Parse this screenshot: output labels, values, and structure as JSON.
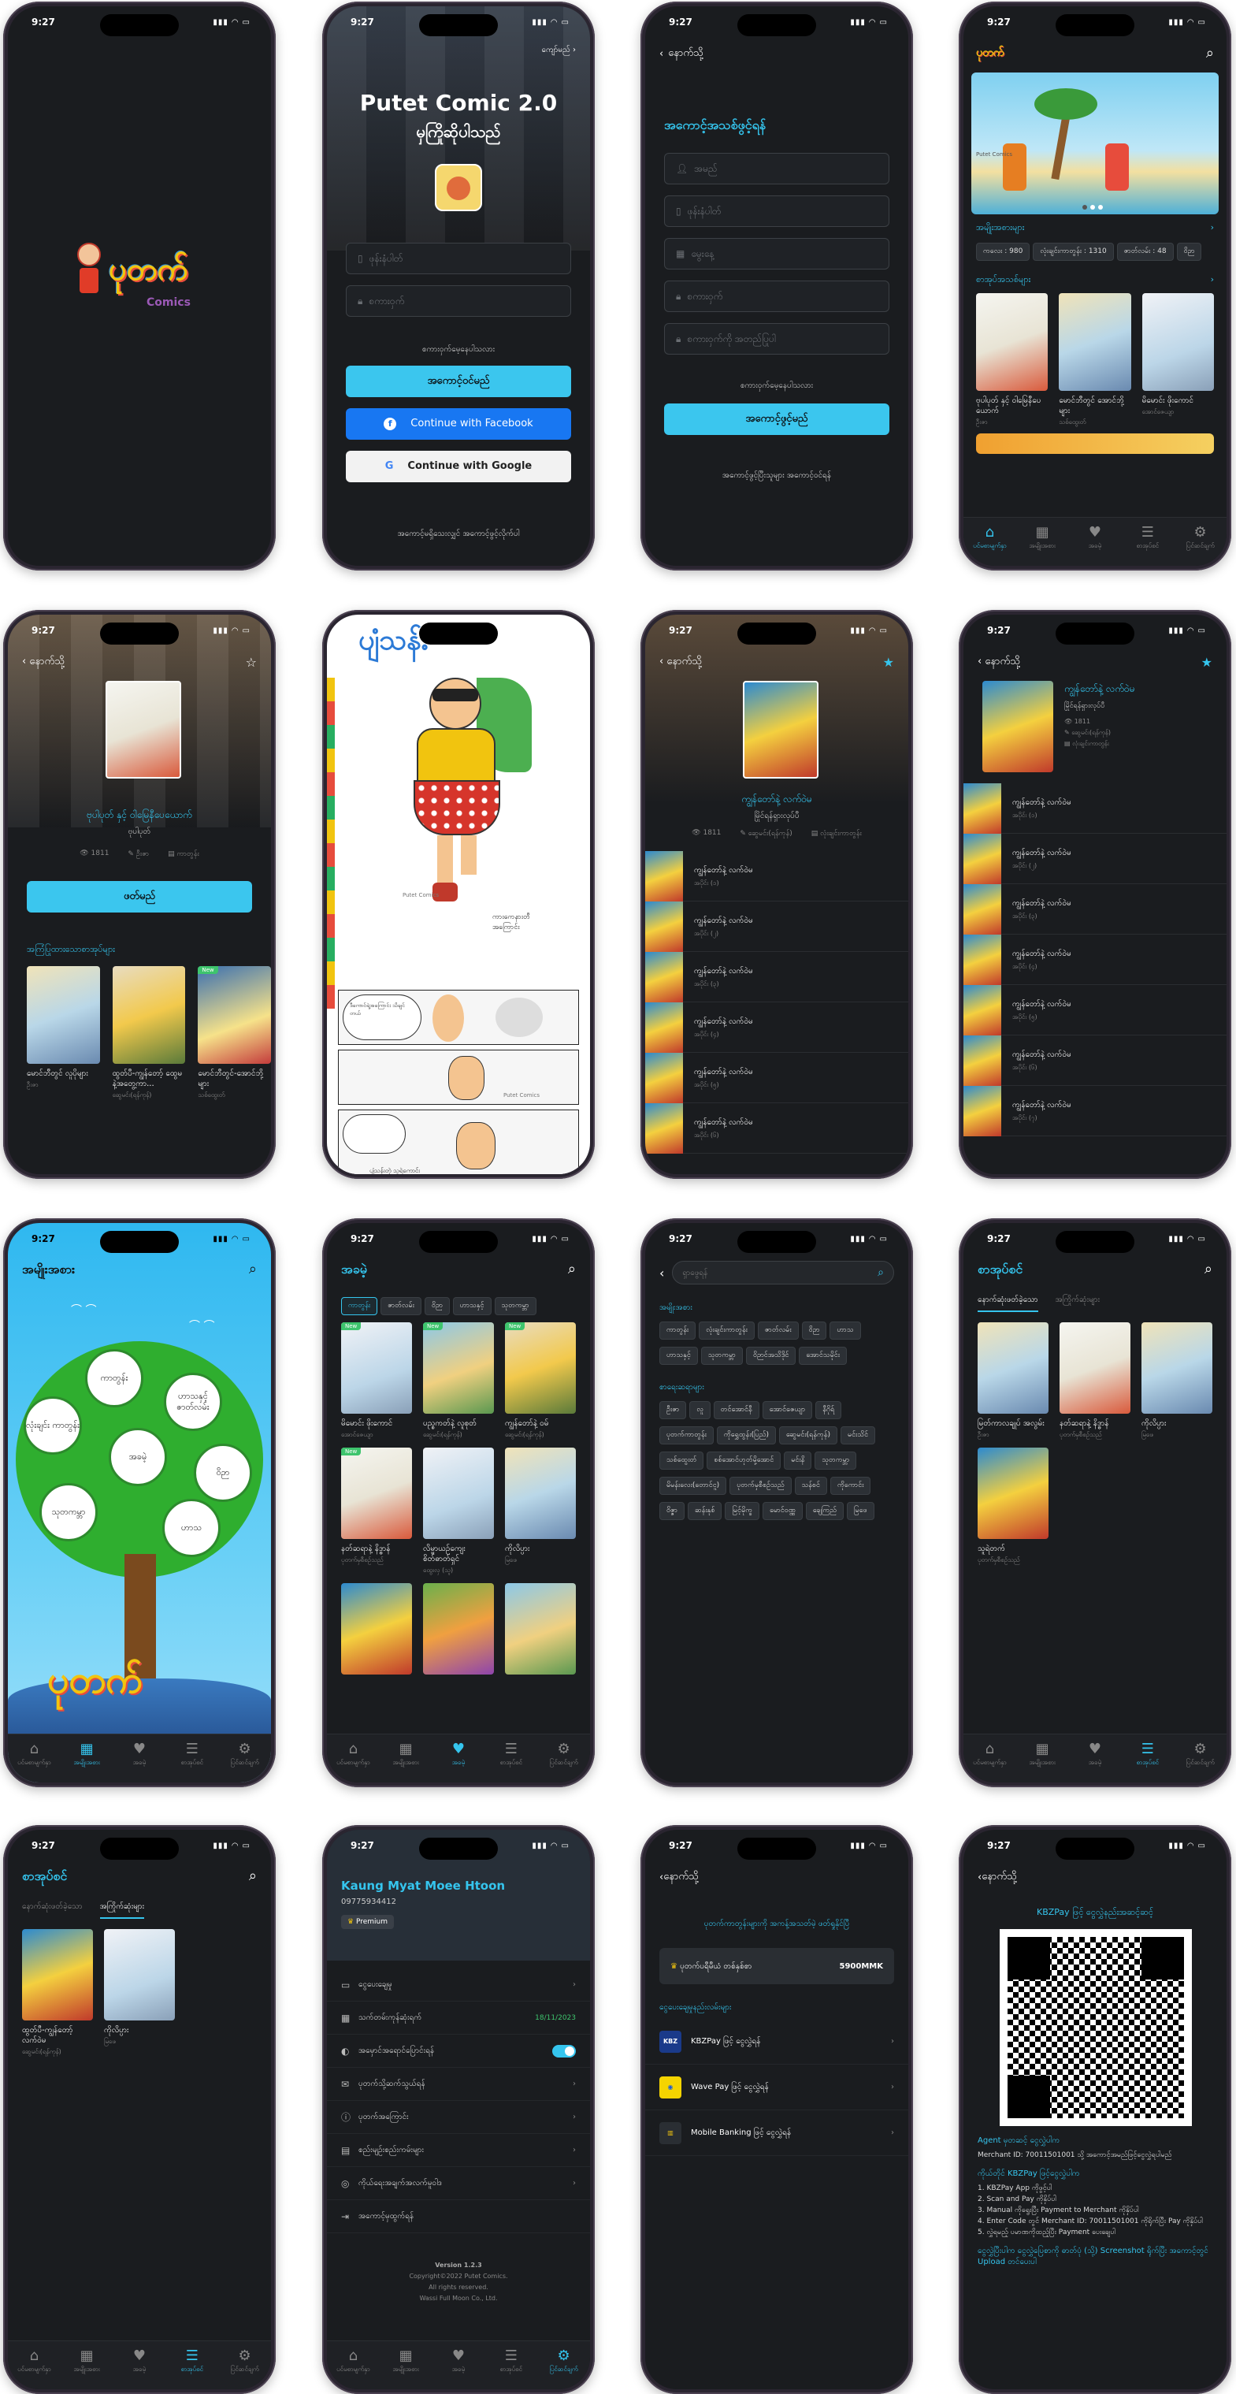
{
  "status_time": "9:27",
  "login": {
    "skip": "ကျော်မည်",
    "title": "Putet Comic 2.0",
    "welcome": "မှကြိုဆိုပါသည်",
    "phone_placeholder": "ဖုန်းနံပါတ်",
    "password_placeholder": "စကားဝှက်",
    "forgot": "စကားဝှက်မေ့နေပါသလား",
    "login_btn": "အကောင့်ဝင်မည်",
    "facebook_btn": "Continue with Facebook",
    "google_btn": "Continue with Google",
    "register_link": "အကောင့်မရှိသေးလျှင် အကောင့်ဖွင့်လိုက်ပါ"
  },
  "logo": {
    "brand": "ပုတက်",
    "sub": "Comics"
  },
  "register": {
    "back": "နောက်သို့",
    "title": "အကောင့်အသစ်ဖွင့်ရန်",
    "fields": [
      "အမည်",
      "ဖုန်းနံပါတ်",
      "မွေးနေ့",
      "စကားဝှက်",
      "စကားဝှက်ကို အတည်ပြုပါ"
    ],
    "forgot": "စကားဝှက်မေ့နေပါသလား",
    "submit": "အကောင့်ဖွင့်မည်",
    "login_link": "အကောင့်ဖွင့်ပြီးသူများ အကောင့်ဝင်ရန်"
  },
  "home": {
    "banner_text": "Putet Comics",
    "genres_title": "အမျိုးအစားများ",
    "genre_chips": [
      "ကလေး : 980",
      "လုံးချင်းကာတွန်း : 1310",
      "ဇာတ်လမ်း : 48",
      "ဝိဉာ"
    ],
    "books_title": "စာအုပ်အသစ်များ",
    "books": [
      {
        "title": "ဗုပါပုတ် နှင့် ဝါမြေနီပေယောက်",
        "author": "ဦးဇာ"
      },
      {
        "title": "မောင်ဘီတွင် အောင်ဘို့များ",
        "author": "သစ်ထွေးတ်"
      },
      {
        "title": "မိမောင်း ဖိုးကောင်",
        "author": "အောင်ဇေယျာ"
      }
    ]
  },
  "tabs": [
    "ပင်မစာမျက်နှာ",
    "အမျိုးအစား",
    "အခမဲ့",
    "စာအုပ်စင်",
    "ပြင်ဆင်ချက်"
  ],
  "detail1": {
    "back": "နောက်သို့",
    "title": "ဗုပါပုတ် နှင့် ဝါမြေနီပေယောက်",
    "author": "ဗုပါပုတ်",
    "views": "1811",
    "writer": "ဦးဇာ",
    "genre": "ကာတွန်း",
    "read_btn": "ဖတ်မည်",
    "related_title": "အကြံပြုထားသောစာအုပ်များ",
    "related": [
      {
        "title": "မောင်ဘီတွင် လူပိုများ",
        "author": "ဦးဇာ"
      },
      {
        "title": "ထွတ်ပီ-ကျွန်တော့် ထွေမနဲ့အတွေ့ကာ...",
        "author": "ဆွေမင်း(ရန်ကုန်)"
      },
      {
        "title": "မောင်ဘီတွင်-အောင်ဘို့များ",
        "author": "သစ်ထွေးတ်"
      }
    ]
  },
  "reader": {
    "wm": "Putet Comics",
    "sfx": "ကားကေနားတီ အကြောင်း",
    "caption": "ပျံသန်းတဲ့ သူရဲကောင်း"
  },
  "detail2": {
    "back": "နောက်သို့",
    "title": "ကျွန်တော်နဲ့ လက်ဝဲမ",
    "subtitle": "မြိုင်ရန်ရှားလုပ်ပီ",
    "views": "1811",
    "writer": "ဆွေမင်း(ရန်ကုန်)",
    "genre": "လုံးချင်းကာတွန်း",
    "episodes": [
      {
        "t": "ကျွန်တော်နဲ့ လက်ဝဲမ",
        "s": "အပိုင်း (၁)"
      },
      {
        "t": "ကျွန်တော်နဲ့ လက်ဝဲမ",
        "s": "အပိုင်း (၂)"
      },
      {
        "t": "ကျွန်တော်နဲ့ လက်ဝဲမ",
        "s": "အပိုင်း (၃)"
      },
      {
        "t": "ကျွန်တော်နဲ့ လက်ဝဲမ",
        "s": "အပိုင်း (၄)"
      },
      {
        "t": "ကျွန်တော်နဲ့ လက်ဝဲမ",
        "s": "အပိုင်း (၅)"
      },
      {
        "t": "ကျွန်တော်နဲ့ လက်ဝဲမ",
        "s": "အပိုင်း (၆)"
      }
    ],
    "episodes_b": [
      {
        "t": "ကျွန်တော်နဲ့ လက်ဝဲမ",
        "s": "အပိုင်း (၁)"
      },
      {
        "t": "ကျွန်တော်နဲ့ လက်ဝဲမ",
        "s": "အပိုင်း (၂)"
      },
      {
        "t": "ကျွန်တော်နဲ့ လက်ဝဲမ",
        "s": "အပိုင်း (၃)"
      },
      {
        "t": "ကျွန်တော်နဲ့ လက်ဝဲမ",
        "s": "အပိုင်း (၄)"
      },
      {
        "t": "ကျွန်တော်နဲ့ လက်ဝဲမ",
        "s": "အပိုင်း (၅)"
      },
      {
        "t": "ကျွန်တော်နဲ့ လက်ဝဲမ",
        "s": "အပိုင်း (၆)"
      },
      {
        "t": "ကျွန်တော်နဲ့ လက်ဝဲမ",
        "s": "အပိုင်း (၇)"
      }
    ]
  },
  "genre_tree": {
    "title": "အမျိုးအစား",
    "nodes": [
      "ကာတွန်း",
      "ဟာသနှင့် ဇာတ်လမ်း",
      "လုံးချင်း ကာတွန်း",
      "အခမဲ့",
      "ဝိဉာ",
      "သုတကမ္ဘာ",
      "ဟာသ"
    ]
  },
  "free": {
    "title": "အခမဲ့",
    "filters": [
      "ကာတွန်း",
      "ဇာတ်လမ်း",
      "ဝိဉာ",
      "ဟာသနှင့်",
      "သုတကမ္ဘာ"
    ],
    "books": [
      {
        "title": "မိမောင်း ဖိုးကောင်",
        "author": "အောင်ဇေယျာ",
        "new": true
      },
      {
        "title": "ပည္စကတ်နဲ့ လူစုတ်",
        "author": "ဆွေမင်း(ရန်ကုန်)",
        "new": true
      },
      {
        "title": "ကျွန်တော်နဲ့ ဝမ်",
        "author": "ဆွေမင်း(ရန်ကုန်)",
        "new": true
      },
      {
        "title": "နတ်ဆရာနဲ့ နိဒ္ဓာန်",
        "author": "ပုတက်မှစီစဉ်သည်",
        "new": true
      },
      {
        "title": "လိမ္မာယဉ်ကျေး စိတ်ဓာတ်ရှင်",
        "author": "ထွေးလှ (သူ)",
        "new": false
      },
      {
        "title": "ကိုလိပ္ပား",
        "author": "မြဖေ",
        "new": false
      }
    ],
    "new_tag": "New"
  },
  "search": {
    "placeholder": "ရှာဖွေရန်",
    "section1": "အမျိုးအစား",
    "chips1": [
      "ကာတွန်း",
      "လုံးချင်းကာတွန်း",
      "ဇာတ်လမ်း",
      "ဝိဉာ",
      "ဟာသ",
      "ဟာသနှင့်",
      "သုတကမ္ဘာ",
      "ဝိဉာင်အသိဒိုင်",
      "အောင်သမိုင်း"
    ],
    "section2": "စာရေးဆရာများ",
    "chips2": [
      "ဦးဇာ",
      "လူ",
      "တင်အောင်နီ",
      "အောင်ဇေယျာ",
      "နီဂိုရ်",
      "ပုတက်ကာတွန်း",
      "ကိုရွှေထွန်း(ပြည်)",
      "ဆွေမင်း(ရန်ကုန်)",
      "မင်းသိင်",
      "သစ်ထွေးတ်",
      "စစ်အောင်ဟုတ်မို့အောင်",
      "မင်းနိ",
      "သုတကမ္ဘာ",
      "မိမန်းလေး(တောင်ငူ)",
      "ပုတက်မှစီစဉ်သည်",
      "သန်စင်",
      "ကိုကောင်း",
      "ဝိဇ္ဇာ",
      "ဆန်းနုစ်",
      "မြင့်မိုက္ခ",
      "မောင်ဝဏ္ဏ",
      "ချေကြည်",
      "မြဖေ"
    ]
  },
  "shelf": {
    "title": "စာအုပ်စင်",
    "tab_history": "နောက်ဆုံးဖတ်ခဲ့သော",
    "tab_fav": "အကြိုက်ဆုံးများ",
    "books": [
      {
        "title": "မြတ်ကာလချုပ် အလွမ်း",
        "author": "ဦးဇာ"
      },
      {
        "title": "နတ်ဆရာနဲ့ နိဒ္ဓာန်",
        "author": "ပုတက်မှစီစဉ်သည်"
      },
      {
        "title": "ကိုလိပ္ပား",
        "author": "မြဖေ"
      },
      {
        "title": "သူရဲတက်",
        "author": "ပုတက်မှစီစဉ်သည်"
      }
    ],
    "fav_books": [
      {
        "title": "ထွတ်ပီ-ကျွန်တော့် လက်ဝဲမ",
        "author": "ဆွေမင်း(ရန်ကုန်)"
      },
      {
        "title": "ကိုလိပ္ပား",
        "author": "မြဖေ"
      }
    ]
  },
  "profile": {
    "name": "Kaung Myat Moee Htoon",
    "phone": "09775934412",
    "badge": "Premium",
    "menu": [
      {
        "icon": "▭",
        "label": "ငွေပေးချေမှု",
        "right": "›"
      },
      {
        "icon": "▦",
        "label": "သက်တမ်းကုန်ဆုံးရက်",
        "right": "18/11/2023"
      },
      {
        "icon": "◐",
        "label": "အမှောင်အရောင်ပြောင်းရန်",
        "right": ""
      },
      {
        "icon": "✉",
        "label": "ပုတက်သို့ဆက်သွယ်ရန်",
        "right": "›"
      },
      {
        "icon": "ⓘ",
        "label": "ပုတက်အကြောင်း",
        "right": "›"
      },
      {
        "icon": "▤",
        "label": "စည်းမျဉ်းစည်းကမ်းများ",
        "right": "›"
      },
      {
        "icon": "◎",
        "label": "ကိုယ်ရေးအချက်အလက်မူဝါဒ",
        "right": "›"
      },
      {
        "icon": "⇥",
        "label": "အကောင့်မှထွက်ရန်",
        "right": ""
      }
    ],
    "version": "Version 1.2.3",
    "copyright": "Copyright©2022 Putet Comics.",
    "rights": "All rights reserved.",
    "company": "Wassi Full Moon Co., Ltd."
  },
  "premium": {
    "back": "နောက်သို့",
    "headline": "ပုတက်ကာတွန်းများကို အကန့်အသတ်မဲ့ ဖတ်ရှုနိုင်ပြီ",
    "plan": "ပုတက်ပရီမီယံ တစ်နှစ်စာ",
    "price": "5900MMK",
    "methods_title": "ငွေပေးချေမှုနည်းလမ်းများ",
    "methods": [
      "KBZPay ဖြင့် ငွေလွှဲရန်",
      "Wave Pay ဖြင့် ငွေလွှဲရန်",
      "Mobile Banking ဖြင့် ငွေလွှဲရန်"
    ]
  },
  "kbz": {
    "back": "နောက်သို့",
    "title": "KBZPay ဖြင့် ငွေလွှဲနည်းအဆင့်ဆင့်",
    "agent_title": "Agent မှတဆင့် ငွေလွှဲပါက",
    "merchant": "Merchant ID: 70011501001 သို့ အကောင့်အမည်ဖြင့်ငွေလွှဲရပါမည်",
    "app_title": "ကိုယ်တိုင် KBZPay ဖြင့်ငွေလွှဲပါက",
    "steps": [
      "1. KBZPay App ကိုဖွင့်ပါ",
      "2. Scan and Pay ကိုနှိပ်ပါ",
      "3. Manual ကိုရွေးပြီး Payment to Merchant ကိုနှိပ်ပါ",
      "4. Enter Code တွင် Merchant ID: 70011501001 ကိုရိုက်ပြီး Pay ကိုနှိပ်ပါ",
      "5. လွှဲရမည့် ပမာဏကိုထည့်ပြီး Payment ပေးချေပါ"
    ],
    "note": "ငွေလွှဲပြီးပါက ငွေလွှဲပြေစာကို ဓာတ်ပုံ (သို့) Screenshot ရိုက်ပြီး အကောင့်တွင် Upload တင်ပေးပါ"
  }
}
